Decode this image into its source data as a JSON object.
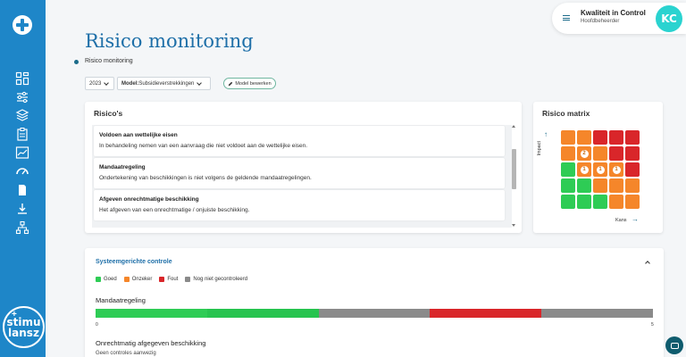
{
  "header": {
    "title": "Risico monitoring",
    "breadcrumb": "Risico monitoring"
  },
  "user": {
    "name": "Kwaliteit in Control",
    "role": "Hoofdbeheerder",
    "initials": "KC"
  },
  "sidebar": {
    "logo_text_1": "stimu",
    "logo_text_2": "lansz",
    "icons": [
      "dashboard-icon",
      "sliders-icon",
      "layers-icon",
      "clipboard-icon",
      "chart-line-icon",
      "gauge-icon",
      "document-icon",
      "download-icon",
      "org-chart-icon"
    ]
  },
  "filters": {
    "year": "2023",
    "model_label": "Model:",
    "model_value": "Subsidieverstrekkingen",
    "edit_button": "Model bewerken"
  },
  "risks": {
    "title": "Risico's",
    "items": [
      {
        "title": "Voldoen aan wettelijke eisen",
        "desc": "In behandeling nemen van een aanvraag die niet voldoet aan de wettelijke eisen."
      },
      {
        "title": "Mandaatregeling",
        "desc": "Ondertekening van beschikkingen is niet volgens de geldende mandaatregelingen."
      },
      {
        "title": "Afgeven onrechtmatige beschikking",
        "desc": "Het afgeven van een onrechtmatige / onjuiste beschikking."
      }
    ]
  },
  "matrix": {
    "title": "Risico matrix",
    "y_label": "Impact",
    "x_label": "Kans",
    "colors": {
      "green": "#2ecc55",
      "orange": "#f5862a",
      "red": "#d9262a",
      "dark_red": "#c81e24"
    },
    "rows": [
      [
        "orange",
        "orange",
        "red",
        "red",
        "red"
      ],
      [
        "orange",
        "orange",
        "orange",
        "red",
        "red"
      ],
      [
        "green",
        "orange",
        "orange",
        "orange",
        "red"
      ],
      [
        "green",
        "green",
        "orange",
        "orange",
        "orange"
      ],
      [
        "green",
        "green",
        "green",
        "orange",
        "orange"
      ]
    ],
    "badges": [
      {
        "row": 1,
        "col": 1,
        "label": "2"
      },
      {
        "row": 2,
        "col": 1,
        "label": "1"
      },
      {
        "row": 2,
        "col": 2,
        "label": "1"
      },
      {
        "row": 2,
        "col": 3,
        "label": "1"
      }
    ]
  },
  "system_control": {
    "title": "Systeemgerichte controle",
    "legend": [
      {
        "label": "Goed",
        "color": "#2ecc55"
      },
      {
        "label": "Onzeker",
        "color": "#f5862a"
      },
      {
        "label": "Fout",
        "color": "#d9262a"
      },
      {
        "label": "Nog niet gecontroleerd",
        "color": "#8a8a8a"
      }
    ],
    "bar_title": "Mandaatregeling",
    "bar_segments": [
      {
        "status": "Goed",
        "color": "#2ecc55",
        "count": 1
      },
      {
        "status": "Goed",
        "color": "#27c44f",
        "count": 1
      },
      {
        "status": "Nog niet gecontroleerd",
        "color": "#8a8a8a",
        "count": 1
      },
      {
        "status": "Fout",
        "color": "#d9262a",
        "count": 1
      },
      {
        "status": "Nog niet gecontroleerd",
        "color": "#8a8a8a",
        "count": 1
      }
    ],
    "bar_min": "0",
    "bar_max": "5",
    "section2_title": "Onrechtmatig afgegeven beschikking",
    "section2_desc": "Geen controles aanwezig"
  }
}
